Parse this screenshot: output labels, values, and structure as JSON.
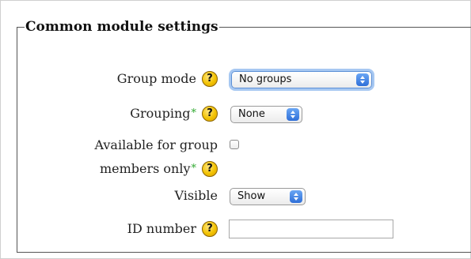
{
  "fieldset": {
    "legend": "Common module settings"
  },
  "fields": {
    "group_mode": {
      "label": "Group mode",
      "help_glyph": "?",
      "value": "No groups"
    },
    "grouping": {
      "label": "Grouping",
      "required_mark": "*",
      "help_glyph": "?",
      "value": "None"
    },
    "available_for_group_members": {
      "label_line1": "Available for group",
      "label_line2": "members only",
      "required_mark": "*",
      "help_glyph": "?",
      "checked": false
    },
    "visible": {
      "label": "Visible",
      "value": "Show"
    },
    "id_number": {
      "label": "ID number",
      "help_glyph": "?",
      "value": ""
    }
  },
  "colors": {
    "required_mark": "#33aa33",
    "help_icon": "#f2c200",
    "select_arrows": "#2f6fd8",
    "focus_ring": "#a7c8f2"
  },
  "icons": {
    "help": "help-question-icon",
    "select_arrows": "updown-arrows-icon"
  }
}
